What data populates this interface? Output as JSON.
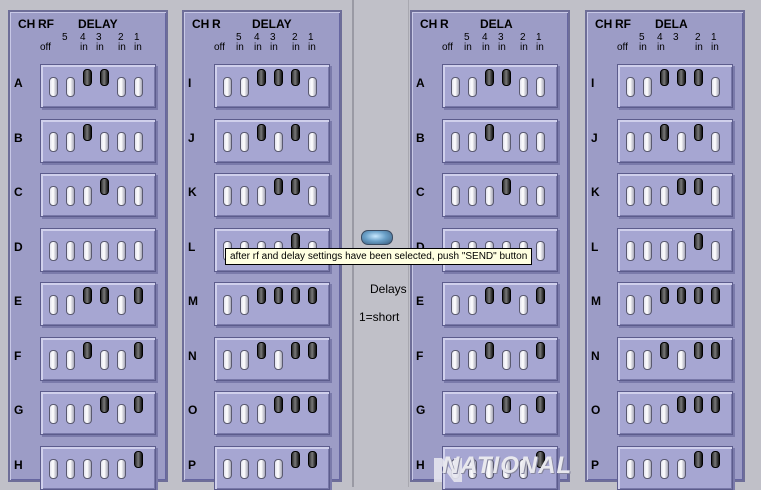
{
  "header_labels": {
    "ch": "CH",
    "delay": "DELAY",
    "dela": "DELA",
    "off": "off"
  },
  "panels": [
    {
      "id": "panel-1",
      "rf": "RF",
      "title_key": "delay",
      "sub": [
        "5",
        "4 in",
        "3 in",
        "2 in",
        "1 in"
      ],
      "rows": [
        {
          "label": "A",
          "on": [
            3,
            4
          ]
        },
        {
          "label": "B",
          "on": [
            3
          ]
        },
        {
          "label": "C",
          "on": [
            4
          ]
        },
        {
          "label": "D",
          "on": []
        },
        {
          "label": "E",
          "on": [
            3,
            4,
            7
          ]
        },
        {
          "label": "F",
          "on": [
            3,
            7
          ]
        },
        {
          "label": "G",
          "on": [
            4,
            7
          ]
        },
        {
          "label": "H",
          "on": [
            7
          ]
        }
      ]
    },
    {
      "id": "panel-2",
      "rf": "R",
      "title_key": "delay",
      "sub": [
        "5 in",
        "4 in",
        "3 in",
        "2 in",
        "1 in"
      ],
      "rows": [
        {
          "label": "I",
          "on": [
            3,
            4,
            5
          ]
        },
        {
          "label": "J",
          "on": [
            3,
            5
          ]
        },
        {
          "label": "K",
          "on": [
            4,
            5
          ]
        },
        {
          "label": "L",
          "on": [
            5
          ]
        },
        {
          "label": "M",
          "on": [
            3,
            4,
            5,
            6
          ]
        },
        {
          "label": "N",
          "on": [
            3,
            5,
            6
          ]
        },
        {
          "label": "O",
          "on": [
            4,
            5,
            6
          ]
        },
        {
          "label": "P",
          "on": [
            5,
            6
          ]
        }
      ]
    },
    {
      "id": "panel-3",
      "rf": "R",
      "title_key": "dela",
      "sub": [
        "5 in",
        "4 in",
        "3 in",
        "2 in",
        "1 in"
      ],
      "rows": [
        {
          "label": "A",
          "on": [
            3,
            4
          ]
        },
        {
          "label": "B",
          "on": [
            3
          ]
        },
        {
          "label": "C",
          "on": [
            4
          ]
        },
        {
          "label": "D",
          "on": []
        },
        {
          "label": "E",
          "on": [
            3,
            4,
            6
          ]
        },
        {
          "label": "F",
          "on": [
            3,
            6
          ]
        },
        {
          "label": "G",
          "on": [
            4,
            6
          ]
        },
        {
          "label": "H",
          "on": [
            6
          ]
        }
      ]
    },
    {
      "id": "panel-4",
      "rf": "RF",
      "title_key": "dela",
      "sub": [
        "5 in",
        "4 in",
        "3",
        "2 in",
        "1 in"
      ],
      "rows": [
        {
          "label": "I",
          "on": [
            3,
            4,
            5
          ]
        },
        {
          "label": "J",
          "on": [
            3,
            5
          ]
        },
        {
          "label": "K",
          "on": [
            4,
            5
          ]
        },
        {
          "label": "L",
          "on": [
            5
          ]
        },
        {
          "label": "M",
          "on": [
            3,
            4,
            5,
            6
          ]
        },
        {
          "label": "N",
          "on": [
            3,
            5,
            6
          ]
        },
        {
          "label": "O",
          "on": [
            4,
            5,
            6
          ]
        },
        {
          "label": "P",
          "on": [
            5,
            6
          ]
        }
      ]
    }
  ],
  "middle": {
    "tooltip": "after rf and delay settings have been selected, push \"SEND\" button",
    "delays_label": "Delays",
    "short_label": "1=short"
  },
  "logo_text": "NATIONAL",
  "colors": {
    "panel_bg": "#9c9cc6",
    "box_bg": "#a6a6d2",
    "tooltip_bg": "#ffffe1"
  }
}
